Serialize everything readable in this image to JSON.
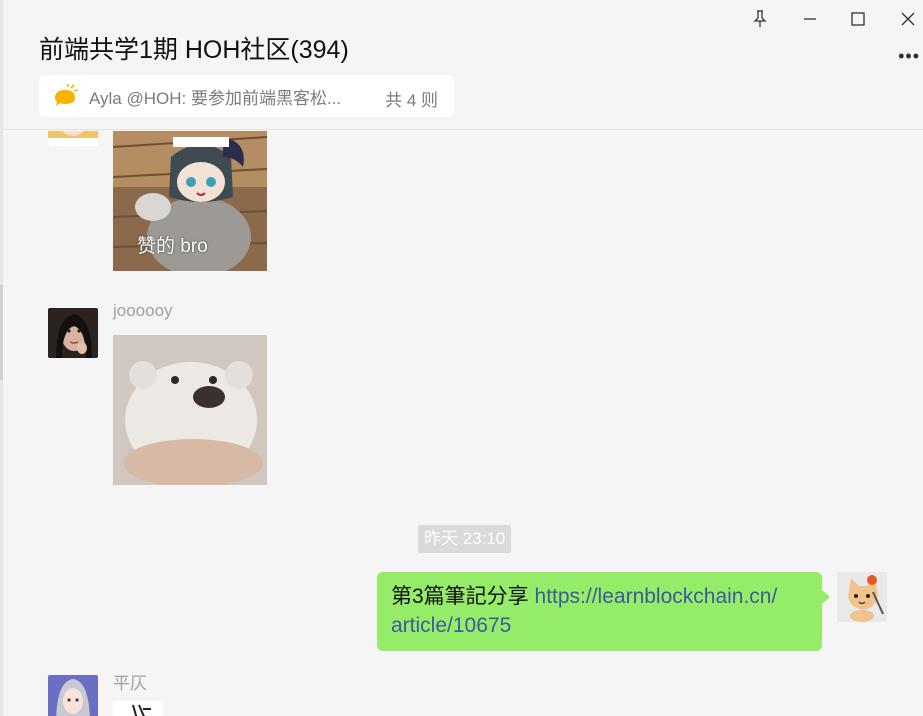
{
  "header": {
    "title": "前端共学1期 HOH社区(394)",
    "window_controls": {
      "pin": "pin-icon",
      "minimize": "minimize-icon",
      "maximize": "maximize-icon",
      "close": "close-icon"
    },
    "more": "•••"
  },
  "announcement": {
    "icon": "megaphone-icon",
    "text": "Ayla @HOH: 要参加前端黑客松...",
    "count": "共 4 则"
  },
  "messages": [
    {
      "type": "image",
      "sticker_caption": "赞的 bro"
    },
    {
      "type": "image",
      "sender": "joooooy"
    },
    {
      "type": "timestamp",
      "text": "昨天 23:10"
    },
    {
      "type": "text",
      "outgoing": true,
      "text_prefix": "第3篇筆記分享 ",
      "link_line1": "https://learnblockchain.cn/",
      "link_line2": "article/10675"
    },
    {
      "type": "image",
      "sender": "平仄"
    }
  ],
  "colors": {
    "bubble_outgoing": "#95ec69",
    "link": "#3d5b9a",
    "background": "#f5f5f5"
  }
}
